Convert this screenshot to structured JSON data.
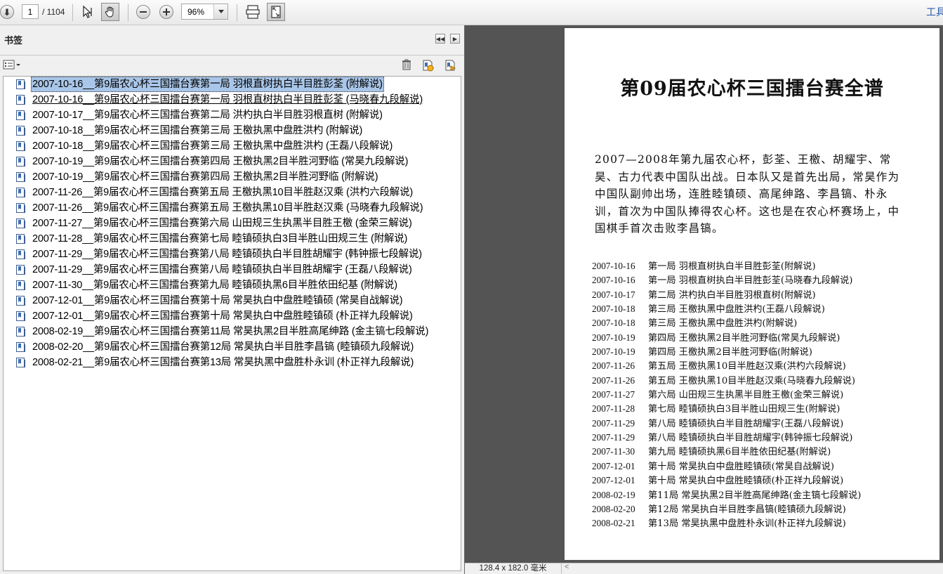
{
  "toolbar": {
    "current_page": "1",
    "page_total": "/ 1104",
    "zoom": "96%",
    "tools_label": "工具"
  },
  "bookmarks_panel": {
    "title": "书签",
    "items": [
      {
        "label": "2007-10-16__第9届农心杯三国擂台赛第一局 羽根直树执白半目胜彭荃 (附解说)"
      },
      {
        "label": "2007-10-16__第9届农心杯三国擂台赛第一局 羽根直树执白半目胜彭荃 (马晓春九段解说)"
      },
      {
        "label": "2007-10-17__第9届农心杯三国擂台赛第二局 洪杓执白半目胜羽根直树 (附解说)"
      },
      {
        "label": "2007-10-18__第9届农心杯三国擂台赛第三局 王檄执黑中盘胜洪杓 (附解说)"
      },
      {
        "label": "2007-10-18__第9届农心杯三国擂台赛第三局 王檄执黑中盘胜洪杓 (王磊八段解说)"
      },
      {
        "label": "2007-10-19__第9届农心杯三国擂台赛第四局 王檄执黑2目半胜河野临 (常昊九段解说)"
      },
      {
        "label": "2007-10-19__第9届农心杯三国擂台赛第四局 王檄执黑2目半胜河野临 (附解说)"
      },
      {
        "label": "2007-11-26__第9届农心杯三国擂台赛第五局 王檄执黑10目半胜赵汉乘 (洪杓六段解说)"
      },
      {
        "label": "2007-11-26__第9届农心杯三国擂台赛第五局 王檄执黑10目半胜赵汉乘 (马晓春九段解说)"
      },
      {
        "label": "2007-11-27__第9届农心杯三国擂台赛第六局 山田规三生执黑半目胜王檄 (金荣三解说)"
      },
      {
        "label": "2007-11-28__第9届农心杯三国擂台赛第七局 睦镇硕执白3目半胜山田规三生 (附解说)"
      },
      {
        "label": "2007-11-29__第9届农心杯三国擂台赛第八局 睦镇硕执白半目胜胡耀宇 (韩钟振七段解说)"
      },
      {
        "label": "2007-11-29__第9届农心杯三国擂台赛第八局 睦镇硕执白半目胜胡耀宇 (王磊八段解说)"
      },
      {
        "label": "2007-11-30__第9届农心杯三国擂台赛第九局 睦镇硕执黑6目半胜依田纪基 (附解说)"
      },
      {
        "label": "2007-12-01__第9届农心杯三国擂台赛第十局 常昊执白中盘胜睦镇硕 (常昊自战解说)"
      },
      {
        "label": "2007-12-01__第9届农心杯三国擂台赛第十局 常昊执白中盘胜睦镇硕 (朴正祥九段解说)"
      },
      {
        "label": "2008-02-19__第9届农心杯三国擂台赛第11局 常昊执黑2目半胜高尾绅路 (金主镐七段解说)"
      },
      {
        "label": "2008-02-20__第9届农心杯三国擂台赛第12局 常昊执白半目胜李昌镐 (睦镇硕九段解说)"
      },
      {
        "label": "2008-02-21__第9届农心杯三国擂台赛第13局 常昊执黑中盘胜朴永训 (朴正祥九段解说)"
      }
    ]
  },
  "document": {
    "title": "第09届农心杯三国擂台赛全谱",
    "intro": "2007—2008年第九届农心杯，彭荃、王檄、胡耀宇、常昊、古力代表中国队出战。日本队又是首先出局，常昊作为中国队副帅出场，连胜睦镇硕、高尾绅路、李昌镐、朴永训，首次为中国队捧得农心杯。这也是在农心杯赛场上，中国棋手首次击败李昌镐。",
    "games": [
      {
        "date": "2007-10-16",
        "text": "第一局 羽根直树执白半目胜彭荃(附解说)"
      },
      {
        "date": "2007-10-16",
        "text": "第一局 羽根直树执白半目胜彭荃(马晓春九段解说)"
      },
      {
        "date": "2007-10-17",
        "text": "第二局 洪杓执白半目胜羽根直树(附解说)"
      },
      {
        "date": "2007-10-18",
        "text": "第三局 王檄执黑中盘胜洪杓(王磊八段解说)"
      },
      {
        "date": "2007-10-18",
        "text": "第三局 王檄执黑中盘胜洪杓(附解说)"
      },
      {
        "date": "2007-10-19",
        "text": "第四局 王檄执黑2目半胜河野临(常昊九段解说)"
      },
      {
        "date": "2007-10-19",
        "text": "第四局 王檄执黑2目半胜河野临(附解说)"
      },
      {
        "date": "2007-11-26",
        "text": "第五局 王檄执黑10目半胜赵汉乘(洪杓六段解说)"
      },
      {
        "date": "2007-11-26",
        "text": "第五局 王檄执黑10目半胜赵汉乘(马晓春九段解说)"
      },
      {
        "date": "2007-11-27",
        "text": "第六局 山田规三生执黑半目胜王檄(金荣三解说)"
      },
      {
        "date": "2007-11-28",
        "text": "第七局 睦镇硕执白3目半胜山田规三生(附解说)"
      },
      {
        "date": "2007-11-29",
        "text": "第八局 睦镇硕执白半目胜胡耀宇(王磊八段解说)"
      },
      {
        "date": "2007-11-29",
        "text": "第八局 睦镇硕执白半目胜胡耀宇(韩钟振七段解说)"
      },
      {
        "date": "2007-11-30",
        "text": "第九局 睦镇硕执黑6目半胜依田纪基(附解说)"
      },
      {
        "date": "2007-12-01",
        "text": "第十局 常昊执白中盘胜睦镇硕(常昊自战解说)"
      },
      {
        "date": "2007-12-01",
        "text": "第十局 常昊执白中盘胜睦镇硕(朴正祥九段解说)"
      },
      {
        "date": "2008-02-19",
        "text": "第11局 常昊执黑2目半胜高尾绅路(金主镐七段解说)"
      },
      {
        "date": "2008-02-20",
        "text": "第12局 常昊执白半目胜李昌镐(睦镇硕九段解说)"
      },
      {
        "date": "2008-02-21",
        "text": "第13局 常昊执黑中盘胜朴永训(朴正祥九段解说)"
      }
    ]
  },
  "status": {
    "page_size": "128.4 x 182.0 毫米"
  }
}
